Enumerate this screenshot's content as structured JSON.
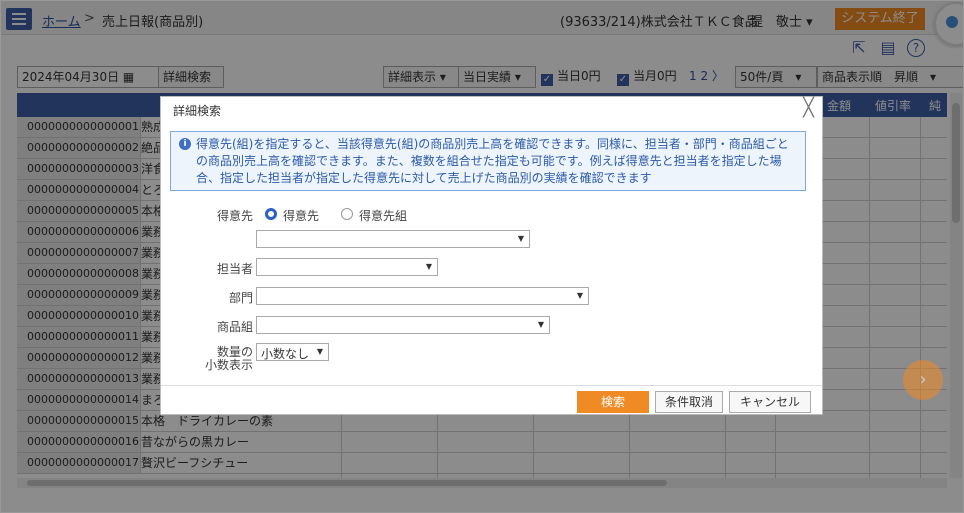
{
  "header": {
    "home_link": "ホーム",
    "separator": ">",
    "page_title": "売上日報(商品別)",
    "company": "(93633/214)株式会社ＴＫＣ食品",
    "user": "堤　敬士 ▾",
    "logout_label": "システム終了"
  },
  "toolbar": {
    "date": "2024年04月30日",
    "detail_search": "詳細検索",
    "detail_display": "詳細表示 ▾",
    "actual": "当日実績 ▾",
    "today_zero": "当日0円",
    "month_zero": "当月0円",
    "page_nav": "1 2 〉",
    "per_page": "50件/頁　▾",
    "sort": "商品表示順　昇順　▾"
  },
  "table": {
    "headers": [
      "金額",
      "値引率",
      "純"
    ],
    "rows": [
      {
        "code": "0000000000000001",
        "name": "熟成"
      },
      {
        "code": "0000000000000002",
        "name": "絶品"
      },
      {
        "code": "0000000000000003",
        "name": "洋食"
      },
      {
        "code": "0000000000000004",
        "name": "とろ"
      },
      {
        "code": "0000000000000005",
        "name": "本格"
      },
      {
        "code": "0000000000000006",
        "name": "業務"
      },
      {
        "code": "0000000000000007",
        "name": "業務"
      },
      {
        "code": "0000000000000008",
        "name": "業務"
      },
      {
        "code": "0000000000000009",
        "name": "業務"
      },
      {
        "code": "0000000000000010",
        "name": "業務"
      },
      {
        "code": "0000000000000011",
        "name": "業務"
      },
      {
        "code": "0000000000000012",
        "name": "業務"
      },
      {
        "code": "0000000000000013",
        "name": "業務"
      },
      {
        "code": "0000000000000014",
        "name": "まろ"
      },
      {
        "code": "0000000000000015",
        "name": "本格　ドライカレーの素"
      },
      {
        "code": "0000000000000016",
        "name": "昔ながらの黒カレー"
      },
      {
        "code": "0000000000000017",
        "name": "贅沢ビーフシチュー"
      }
    ]
  },
  "modal": {
    "title": "詳細検索",
    "close": "╳",
    "info_lines": [
      "得意先(組)を指定すると、当該得意先(組)の商品別売上高を確認できます。同様に、担当者・部門・商品組ごと",
      "の商品別売上高を確認できます。また、複数を組合せた指定も可能です。例えば得意先と担当者を指定した場",
      "合、指定した担当者が指定した得意先に対して売上げた商品別の実績を確認できます"
    ],
    "customer_label": "得意先",
    "radio_customer": "得意先",
    "radio_group": "得意先組",
    "staff_label": "担当者",
    "dept_label": "部門",
    "product_group_label": "商品組",
    "qty_label_1": "数量の",
    "qty_label_2": "小数表示",
    "qty_value": "小数なし",
    "search_btn": "検索",
    "clear_btn": "条件取消",
    "cancel_btn": "キャンセル"
  }
}
